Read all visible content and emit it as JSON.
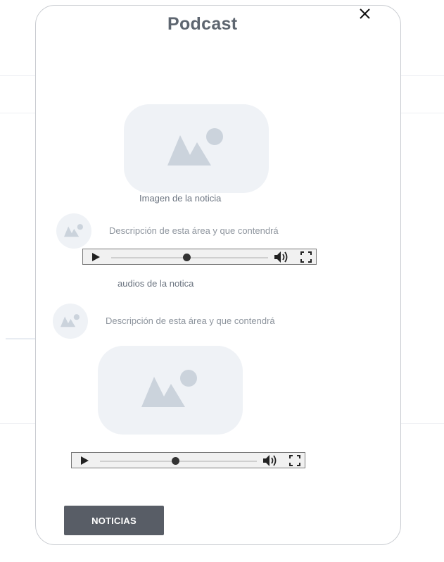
{
  "modal": {
    "title": "Podcast",
    "close_icon": "close-icon"
  },
  "section1": {
    "image_caption": "Imagen de la noticia",
    "description": "Descripción de esta área y que contendrá",
    "audio_caption": "audios de la notica"
  },
  "section2": {
    "description": "Descripción de esta área y que contendrá"
  },
  "audio_players": [
    {
      "progress": 0.48
    },
    {
      "progress": 0.48
    }
  ],
  "footer": {
    "button_label": "NOTICIAS"
  },
  "colors": {
    "placeholder_bg": "#eff2f6",
    "placeholder_icon": "#cbd3dc",
    "button_bg": "#585d66",
    "title": "#5e6670"
  }
}
